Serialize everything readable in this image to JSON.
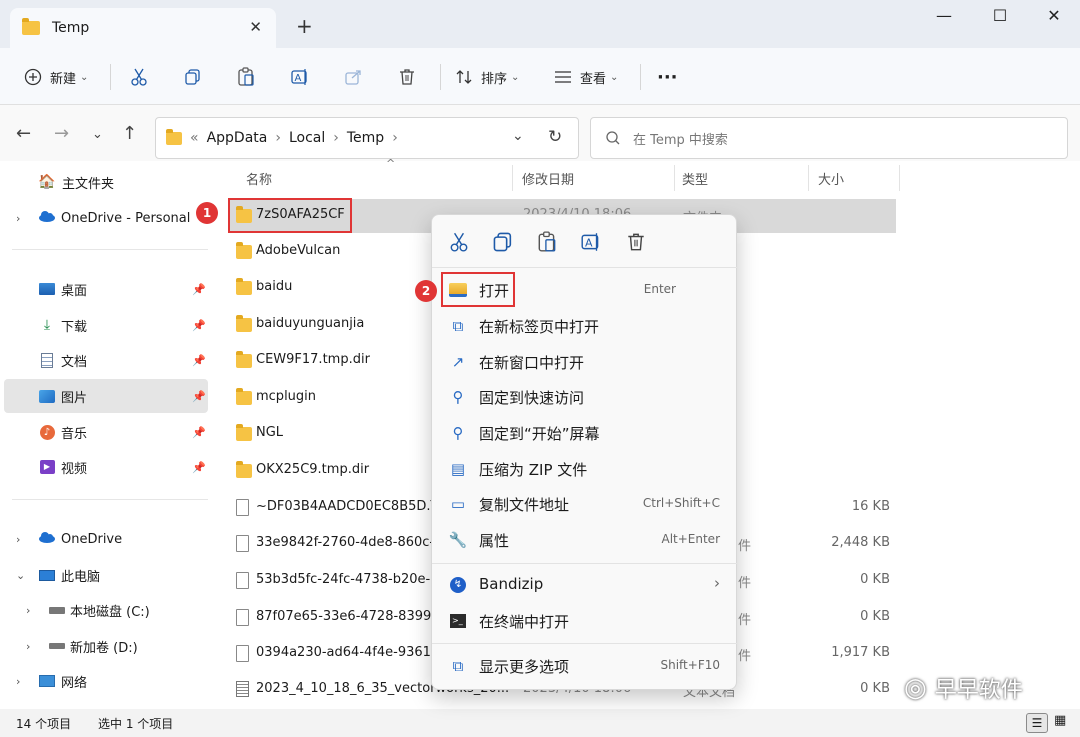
{
  "window": {
    "tab_title": "Temp",
    "close_tab": "✕",
    "new_tab": "+",
    "minimize": "—",
    "maximize": "☐",
    "close": "✕"
  },
  "toolbar": {
    "new_label": "新建",
    "sort_label": "排序",
    "view_label": "查看",
    "more": "···"
  },
  "address": {
    "overflow": "«",
    "crumbs": [
      "AppData",
      "Local",
      "Temp"
    ],
    "separator": "›",
    "search_placeholder": "在 Temp 中搜索"
  },
  "sidebar": {
    "items": [
      {
        "label": "主文件夹",
        "icon": "home-icon"
      },
      {
        "label": "OneDrive - Personal",
        "icon": "cloud-icon"
      },
      {
        "label": "桌面",
        "icon": "desktop-icon"
      },
      {
        "label": "下载",
        "icon": "download-icon"
      },
      {
        "label": "文档",
        "icon": "document-icon"
      },
      {
        "label": "图片",
        "icon": "picture-icon"
      },
      {
        "label": "音乐",
        "icon": "music-icon"
      },
      {
        "label": "视频",
        "icon": "video-icon"
      },
      {
        "label": "OneDrive",
        "icon": "cloud-icon"
      },
      {
        "label": "此电脑",
        "icon": "computer-icon"
      },
      {
        "label": "本地磁盘 (C:)",
        "icon": "drive-icon"
      },
      {
        "label": "新加卷 (D:)",
        "icon": "drive-icon"
      },
      {
        "label": "网络",
        "icon": "network-icon"
      }
    ]
  },
  "columns": {
    "name": "名称",
    "date": "修改日期",
    "type": "类型",
    "size": "大小"
  },
  "files": [
    {
      "name": "7zS0AFA25CF",
      "date": "2023/4/10 18:06",
      "type": "文件夹",
      "size": ""
    },
    {
      "name": "AdobeVulcan",
      "date": "",
      "type": "",
      "size": ""
    },
    {
      "name": "baidu",
      "date": "",
      "type": "",
      "size": ""
    },
    {
      "name": "baiduyunguanjia",
      "date": "",
      "type": "",
      "size": ""
    },
    {
      "name": "CEW9F17.tmp.dir",
      "date": "",
      "type": "",
      "size": ""
    },
    {
      "name": "mcplugin",
      "date": "",
      "type": "",
      "size": ""
    },
    {
      "name": "NGL",
      "date": "",
      "type": "",
      "size": ""
    },
    {
      "name": "OKX25C9.tmp.dir",
      "date": "",
      "type": "",
      "size": ""
    },
    {
      "name": "~DF03B4AADCD0EC8B5D.T",
      "date": "",
      "type": "",
      "size": "16 KB"
    },
    {
      "name": "33e9842f-2760-4de8-860c-",
      "date": "",
      "type": "件",
      "size": "2,448 KB"
    },
    {
      "name": "53b3d5fc-24fc-4738-b20e-",
      "date": "",
      "type": "件",
      "size": "0 KB"
    },
    {
      "name": "87f07e65-33e6-4728-8399-",
      "date": "",
      "type": "件",
      "size": "0 KB"
    },
    {
      "name": "0394a230-ad64-4f4e-9361-",
      "date": "",
      "type": "件",
      "size": "1,917 KB"
    },
    {
      "name": "2023_4_10_18_6_35_vectorworks_20...",
      "date": "2023/4/10 18:06",
      "type": "文本文档",
      "size": "0 KB"
    }
  ],
  "status": {
    "count": "14 个项目",
    "selected": "选中 1 个项目"
  },
  "context_menu": {
    "items": [
      {
        "label": "打开",
        "shortcut": "Enter",
        "icon": "folder-open-icon"
      },
      {
        "label": "在新标签页中打开",
        "shortcut": "",
        "icon": "new-tab-icon"
      },
      {
        "label": "在新窗口中打开",
        "shortcut": "",
        "icon": "new-window-icon"
      },
      {
        "label": "固定到快速访问",
        "shortcut": "",
        "icon": "pin-icon"
      },
      {
        "label": "固定到“开始”屏幕",
        "shortcut": "",
        "icon": "pin-icon"
      },
      {
        "label": "压缩为 ZIP 文件",
        "shortcut": "",
        "icon": "zip-icon"
      },
      {
        "label": "复制文件地址",
        "shortcut": "Ctrl+Shift+C",
        "icon": "copy-path-icon"
      },
      {
        "label": "属性",
        "shortcut": "Alt+Enter",
        "icon": "wrench-icon"
      },
      {
        "label": "Bandizip",
        "shortcut": "",
        "icon": "bandizip-icon"
      },
      {
        "label": "在终端中打开",
        "shortcut": "",
        "icon": "terminal-icon"
      },
      {
        "label": "显示更多选项",
        "shortcut": "Shift+F10",
        "icon": "more-options-icon"
      }
    ],
    "submenu_arrow": "›"
  },
  "annotations": {
    "badge1": "1",
    "badge2": "2"
  },
  "watermark": "早早软件",
  "colors": {
    "accent": "#2b6cc4",
    "highlight_red": "#e03535",
    "folder": "#f6c344",
    "selected_row": "#d9d9d9"
  }
}
